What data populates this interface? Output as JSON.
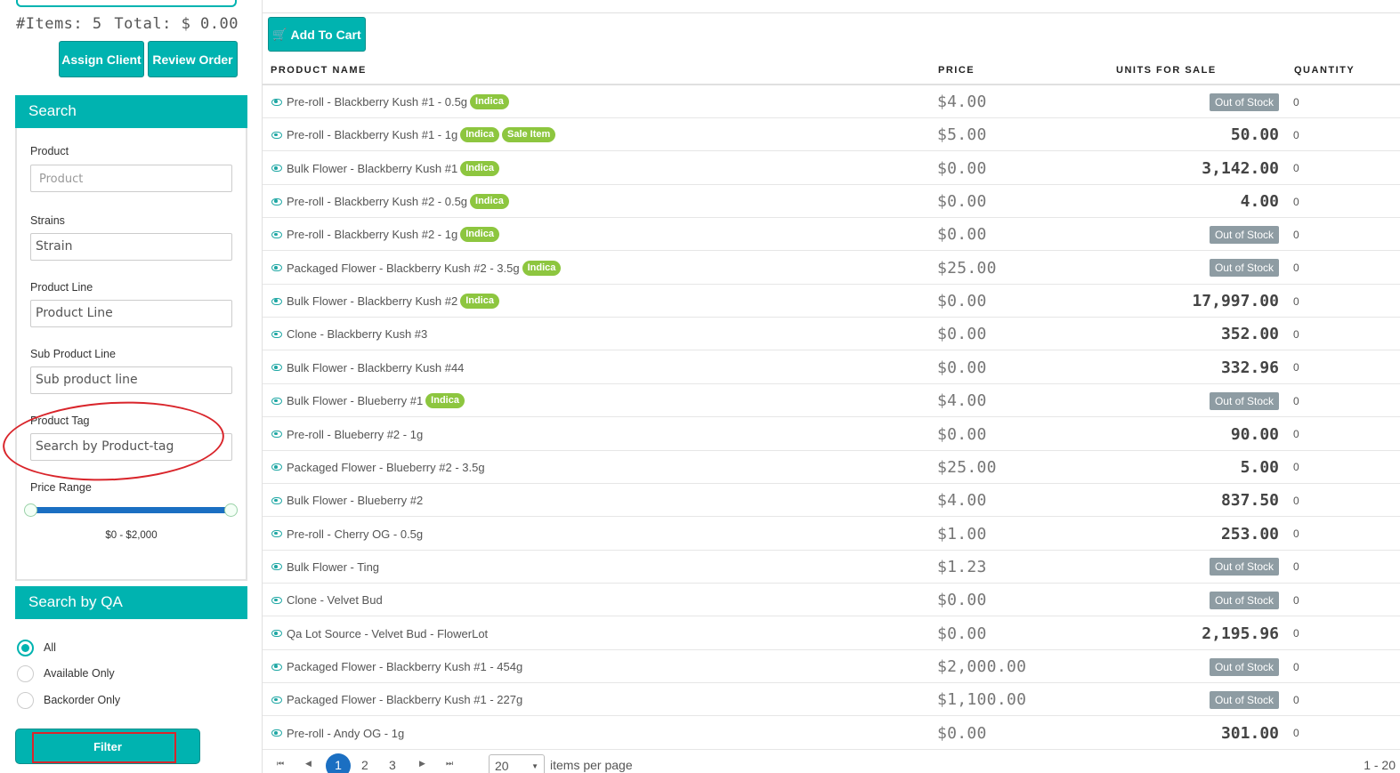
{
  "cart": {
    "items_label": "#Items:",
    "items_count": "5",
    "total_label": "Total:",
    "total_value": "$ 0.00",
    "assign_client_label": "Assign Client",
    "review_order_label": "Review Order"
  },
  "search": {
    "title": "Search",
    "product_label": "Product",
    "product_placeholder": "Product",
    "strains_label": "Strains",
    "strains_value": "Strain",
    "product_line_label": "Product Line",
    "product_line_value": "Product Line",
    "sub_product_line_label": "Sub Product Line",
    "sub_product_line_value": "Sub product line",
    "product_tag_label": "Product Tag",
    "product_tag_value": "Search by Product-tag",
    "price_range_label": "Price Range",
    "price_range_text": "$0 - $2,000"
  },
  "qa": {
    "title": "Search by QA",
    "options": [
      "All",
      "Available Only",
      "Backorder Only"
    ],
    "selected": "All"
  },
  "filter_label": "Filter",
  "add_to_cart_label": "Add To Cart",
  "table": {
    "headers": [
      "PRODUCT NAME",
      "PRICE",
      "UNITS FOR SALE",
      "QUANTITY"
    ],
    "rows": [
      {
        "name": "Pre-roll - Blackberry Kush #1 - 0.5g",
        "tags": [
          "Indica"
        ],
        "price": "$4.00",
        "units": "Out of Stock",
        "qty": "0"
      },
      {
        "name": "Pre-roll - Blackberry Kush #1 - 1g",
        "tags": [
          "Indica",
          "Sale Item"
        ],
        "price": "$5.00",
        "units": "50.00",
        "qty": "0"
      },
      {
        "name": "Bulk Flower - Blackberry Kush #1",
        "tags": [
          "Indica"
        ],
        "price": "$0.00",
        "units": "3,142.00",
        "qty": "0"
      },
      {
        "name": "Pre-roll - Blackberry Kush #2 - 0.5g",
        "tags": [
          "Indica"
        ],
        "price": "$0.00",
        "units": "4.00",
        "qty": "0"
      },
      {
        "name": "Pre-roll - Blackberry Kush #2 - 1g",
        "tags": [
          "Indica"
        ],
        "price": "$0.00",
        "units": "Out of Stock",
        "qty": "0"
      },
      {
        "name": "Packaged Flower - Blackberry Kush #2 - 3.5g",
        "tags": [
          "Indica"
        ],
        "price": "$25.00",
        "units": "Out of Stock",
        "qty": "0"
      },
      {
        "name": "Bulk Flower - Blackberry Kush #2",
        "tags": [
          "Indica"
        ],
        "price": "$0.00",
        "units": "17,997.00",
        "qty": "0"
      },
      {
        "name": "Clone - Blackberry Kush #3",
        "tags": [],
        "price": "$0.00",
        "units": "352.00",
        "qty": "0"
      },
      {
        "name": "Bulk Flower - Blackberry Kush #44",
        "tags": [],
        "price": "$0.00",
        "units": "332.96",
        "qty": "0"
      },
      {
        "name": "Bulk Flower - Blueberry #1",
        "tags": [
          "Indica"
        ],
        "price": "$4.00",
        "units": "Out of Stock",
        "qty": "0"
      },
      {
        "name": "Pre-roll - Blueberry #2 - 1g",
        "tags": [],
        "price": "$0.00",
        "units": "90.00",
        "qty": "0"
      },
      {
        "name": "Packaged Flower - Blueberry #2 - 3.5g",
        "tags": [],
        "price": "$25.00",
        "units": "5.00",
        "qty": "0"
      },
      {
        "name": "Bulk Flower - Blueberry #2",
        "tags": [],
        "price": "$4.00",
        "units": "837.50",
        "qty": "0"
      },
      {
        "name": "Pre-roll - Cherry OG - 0.5g",
        "tags": [],
        "price": "$1.00",
        "units": "253.00",
        "qty": "0"
      },
      {
        "name": "Bulk Flower - Ting",
        "tags": [],
        "price": "$1.23",
        "units": "Out of Stock",
        "qty": "0"
      },
      {
        "name": "Clone - Velvet Bud",
        "tags": [],
        "price": "$0.00",
        "units": "Out of Stock",
        "qty": "0"
      },
      {
        "name": "Qa Lot Source - Velvet Bud - FlowerLot",
        "tags": [],
        "price": "$0.00",
        "units": "2,195.96",
        "qty": "0"
      },
      {
        "name": "Packaged Flower - Blackberry Kush #1 - 454g",
        "tags": [],
        "price": "$2,000.00",
        "units": "Out of Stock",
        "qty": "0"
      },
      {
        "name": "Packaged Flower - Blackberry Kush #1 - 227g",
        "tags": [],
        "price": "$1,100.00",
        "units": "Out of Stock",
        "qty": "0"
      },
      {
        "name": "Pre-roll - Andy OG - 1g",
        "tags": [],
        "price": "$0.00",
        "units": "301.00",
        "qty": "0"
      }
    ]
  },
  "pagination": {
    "pages": [
      "1",
      "2",
      "3"
    ],
    "current": "1",
    "per_page": "20",
    "per_page_label": "items per page",
    "range_label": "1 - 20"
  },
  "colors": {
    "accent": "#00b3b0",
    "tag": "#8dc63f",
    "out_of_stock": "#8e9ca3",
    "annotation": "#d9252b",
    "slider": "#1b6fc2"
  }
}
